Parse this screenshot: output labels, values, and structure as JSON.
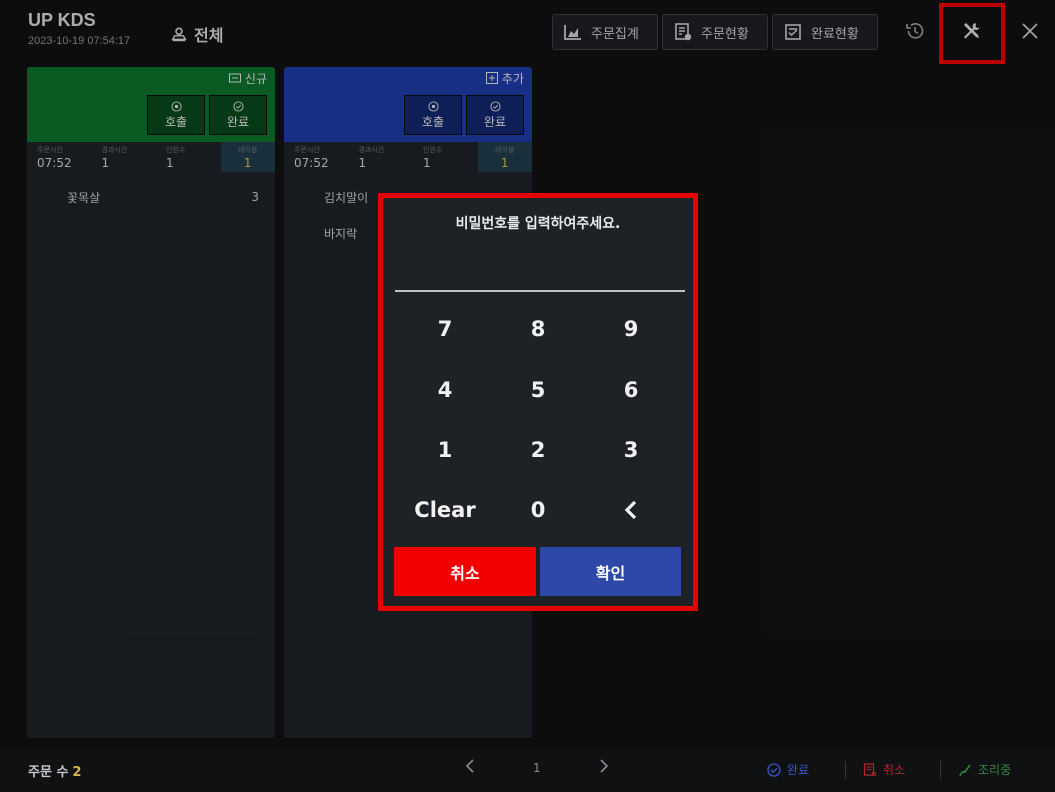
{
  "header": {
    "app_title": "UP KDS",
    "datetime": "2023-10-19 07:54:17",
    "store_name": "전체",
    "buttons": {
      "order_summary": "주문집계",
      "order_status": "주문현황",
      "complete_status": "완료현황"
    },
    "icons": [
      "chart-icon",
      "document-icon",
      "checklist-icon",
      "history-icon",
      "tools-icon",
      "close-icon"
    ]
  },
  "orders": [
    {
      "badge": "신규",
      "color": "#0d6e2c",
      "call_label": "호출",
      "done_label": "완료",
      "meta": {
        "order_time_label": "주문시간",
        "order_time": "07:52",
        "elapsed_label": "경과시간",
        "elapsed": "1",
        "people_label": "인원수",
        "people": "1",
        "table_label": "테이블",
        "table": "1"
      },
      "items": [
        {
          "name": "꽃목살",
          "qty": "3"
        }
      ]
    },
    {
      "badge": "추가",
      "color": "#1d3aa3",
      "call_label": "호출",
      "done_label": "완료",
      "meta": {
        "order_time_label": "주문시간",
        "order_time": "07:52",
        "elapsed_label": "경과시간",
        "elapsed": "1",
        "people_label": "인원수",
        "people": "1",
        "table_label": "테이블",
        "table": "1"
      },
      "items": [
        {
          "name": "김치말이",
          "qty": ""
        },
        {
          "name": "바지락",
          "qty": ""
        }
      ]
    }
  ],
  "dialog": {
    "title": "비밀번호를 입력하여주세요.",
    "input_value": "",
    "keys": [
      "7",
      "8",
      "9",
      "4",
      "5",
      "6",
      "1",
      "2",
      "3",
      "Clear",
      "0"
    ],
    "backspace_icon": "chevron-left-icon",
    "cancel_label": "취소",
    "confirm_label": "확인"
  },
  "footer": {
    "order_count_label": "주문 수",
    "order_count": "2",
    "page": "1",
    "actions": {
      "complete": "완료",
      "cancel": "취소",
      "cooking": "조리중"
    },
    "colors": {
      "complete": "#3b56c8",
      "cancel": "#b9232f",
      "cooking": "#2e8a3e"
    }
  }
}
